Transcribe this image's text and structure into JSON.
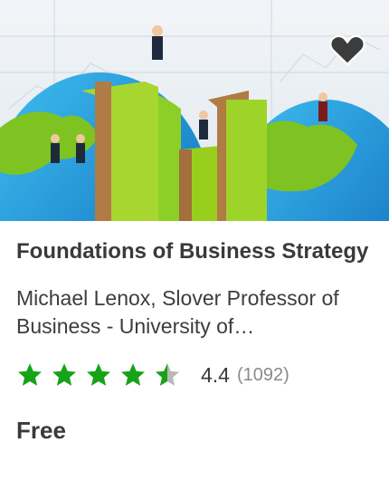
{
  "course": {
    "title": "Foundations of Business Strategy",
    "instructor": "Michael Lenox, Slover Professor of Business - University of…",
    "rating": 4.4,
    "rating_value_label": "4.4",
    "rating_count_label": "(1092)",
    "price": "Free"
  },
  "icons": {
    "wishlist": "heart-icon",
    "rating_star": "star-icon"
  },
  "colors": {
    "star_filled": "#17a317",
    "star_empty": "#b8b8b8",
    "text_dark": "#3a3a3a",
    "text_muted": "#8a8a8a"
  }
}
